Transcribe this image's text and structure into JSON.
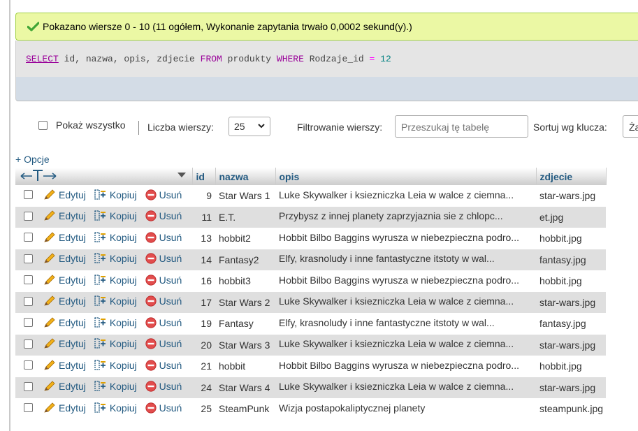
{
  "message": {
    "text": "Pokazano wiersze 0 - 10 (11 ogółem, Wykonanie zapytania trwało 0,0002 sekund(y).)"
  },
  "sql": {
    "select": "SELECT",
    "cols": " id, nazwa, opis, zdjecie ",
    "from": "FROM",
    "table": " produkty ",
    "where": "WHERE",
    "field": " Rodzaje_id ",
    "op": "=",
    "value": " 12"
  },
  "controls": {
    "show_all": "Pokaż wszystko",
    "rows_label": "Liczba wierszy:",
    "rows_value": "25",
    "filter_label": "Filtrowanie wierszy:",
    "filter_placeholder": "Przeszukaj tę tabelę",
    "sort_label": "Sortuj wg klucza:",
    "sort_value": "Ża"
  },
  "options_link": "+ Opcje",
  "columns": [
    "id",
    "nazwa",
    "opis",
    "zdjecie"
  ],
  "actions": {
    "edit": "Edytuj",
    "copy": "Kopiuj",
    "delete": "Usuń"
  },
  "rows": [
    {
      "id": "9",
      "nazwa": "Star Wars 1",
      "opis": "Luke Skywalker i ksiezniczka Leia w walce z ciemna...",
      "zdjecie": "star-wars.jpg"
    },
    {
      "id": "11",
      "nazwa": "E.T.",
      "opis": "Przybysz z innej planety zaprzyjaznia sie z chlopc...",
      "zdjecie": "et.jpg"
    },
    {
      "id": "13",
      "nazwa": "hobbit2",
      "opis": "Hobbit Bilbo Baggins wyrusza w niebezpieczna podro...",
      "zdjecie": "hobbit.jpg"
    },
    {
      "id": "14",
      "nazwa": "Fantasy2",
      "opis": "Elfy, krasnoludy i inne fantastyczne itstoty w wal...",
      "zdjecie": "fantasy.jpg"
    },
    {
      "id": "16",
      "nazwa": "hobbit3",
      "opis": "Hobbit Bilbo Baggins wyrusza w niebezpieczna podro...",
      "zdjecie": "hobbit.jpg"
    },
    {
      "id": "17",
      "nazwa": "Star Wars 2",
      "opis": "Luke Skywalker i ksiezniczka Leia w walce z ciemna...",
      "zdjecie": "star-wars.jpg"
    },
    {
      "id": "19",
      "nazwa": "Fantasy",
      "opis": "Elfy, krasnoludy i inne fantastyczne itstoty w wal...",
      "zdjecie": "fantasy.jpg"
    },
    {
      "id": "20",
      "nazwa": "Star Wars 3",
      "opis": "Luke Skywalker i ksiezniczka Leia w walce z ciemna...",
      "zdjecie": "star-wars.jpg"
    },
    {
      "id": "21",
      "nazwa": "hobbit",
      "opis": "Hobbit Bilbo Baggins wyrusza w niebezpieczna podro...",
      "zdjecie": "hobbit.jpg"
    },
    {
      "id": "24",
      "nazwa": "Star Wars 4",
      "opis": "Luke Skywalker i ksiezniczka Leia w walce z ciemna...",
      "zdjecie": "star-wars.jpg"
    },
    {
      "id": "25",
      "nazwa": "SteamPunk",
      "opis": "Wizja postapokaliptycznej planety",
      "zdjecie": "steampunk.jpg"
    }
  ],
  "colors": {
    "link": "#235a81",
    "success_bg": "#ebf8a4",
    "row_even": "#dfdfdf"
  }
}
